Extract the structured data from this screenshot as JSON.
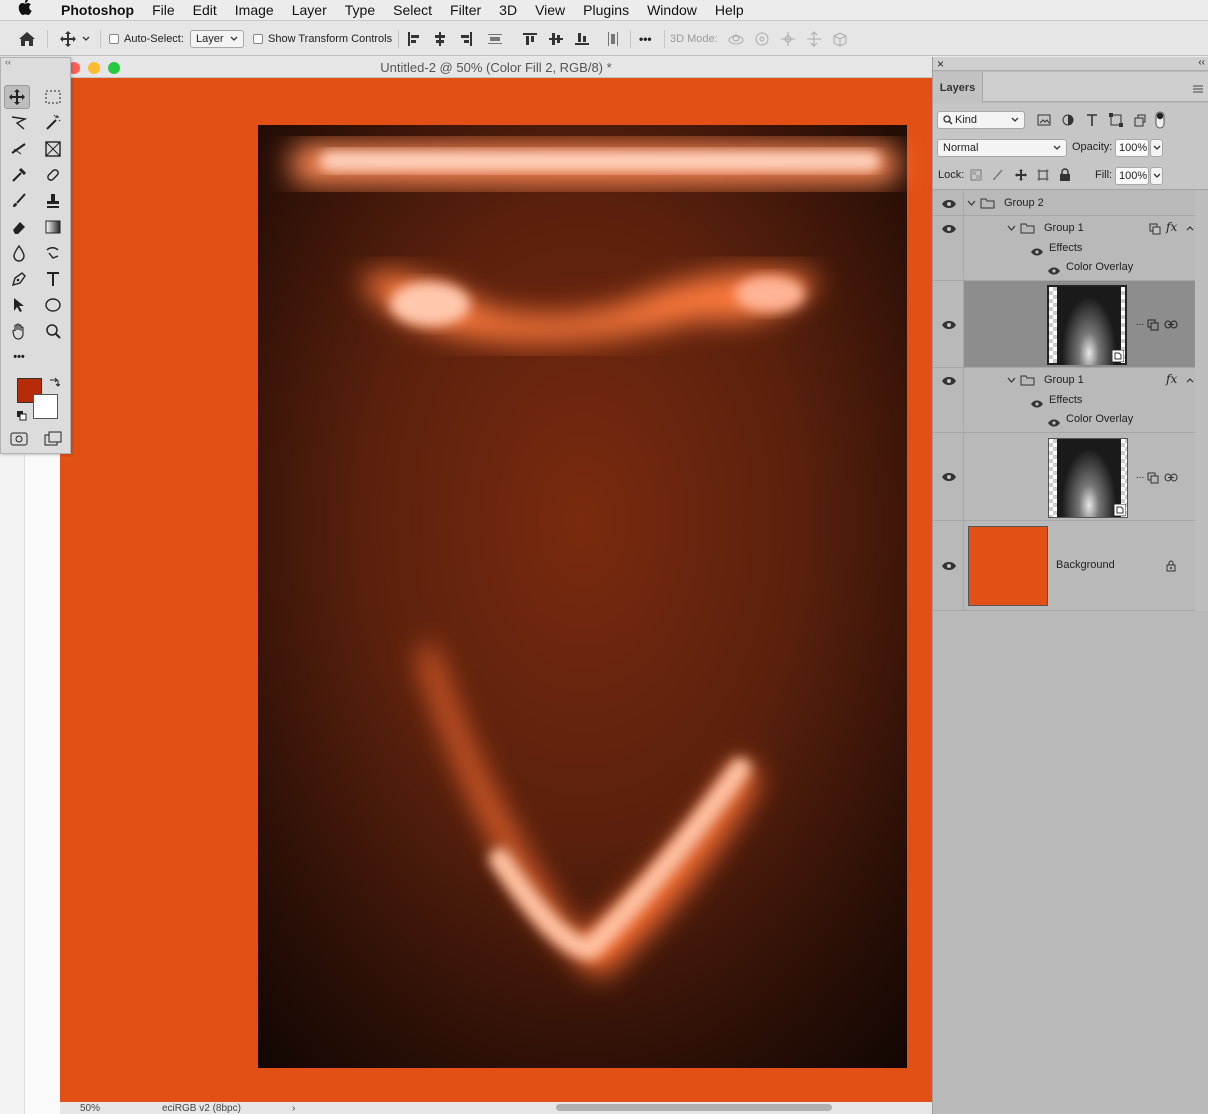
{
  "menubar": {
    "app_name": "Photoshop",
    "items": [
      "File",
      "Edit",
      "Image",
      "Layer",
      "Type",
      "Select",
      "Filter",
      "3D",
      "View",
      "Plugins",
      "Window",
      "Help"
    ]
  },
  "options_bar": {
    "auto_select_label": "Auto-Select:",
    "auto_select_value": "Layer",
    "show_transform_label": "Show Transform Controls",
    "more_label": "•••",
    "three_d_mode_label": "3D Mode:"
  },
  "document": {
    "title": "Untitled-2 @ 50% (Color Fill 2, RGB/8) *",
    "zoom": "50%",
    "profile": "eciRGB v2 (8bpc)",
    "status_arrow": "›",
    "background_color": "#e25016"
  },
  "tools": {
    "collapse": "‹‹",
    "foreground_color": "#b72c08",
    "background_color": "#ffffff",
    "more": "•••"
  },
  "layers_panel": {
    "close": "×",
    "collapse": "‹‹",
    "tab_label": "Layers",
    "filter_kind": "Kind",
    "blend_mode": "Normal",
    "opacity_label": "Opacity:",
    "opacity_value": "100%",
    "lock_label": "Lock:",
    "fill_label": "Fill:",
    "fill_value": "100%",
    "rows": {
      "group2": "Group 2",
      "group1a": "Group 1",
      "effects_a": "Effects",
      "overlay_a": "Color Overlay",
      "group1b": "Group 1",
      "effects_b": "Effects",
      "overlay_b": "Color Overlay",
      "background": "Background"
    },
    "fx": "fx",
    "dots": "..."
  }
}
